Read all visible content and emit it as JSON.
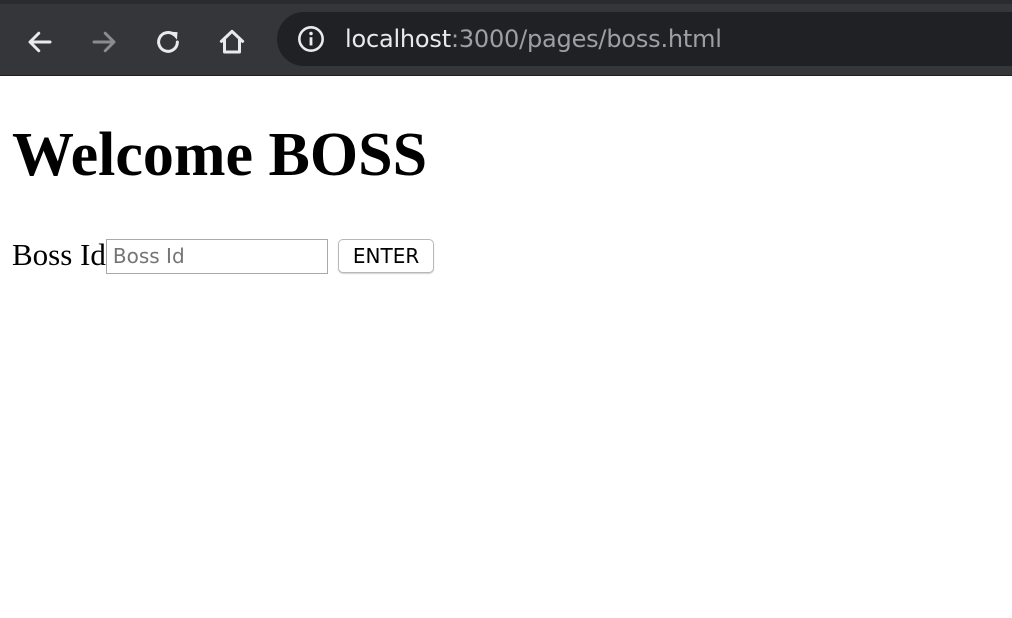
{
  "browser": {
    "url_host": "localhost",
    "url_rest": ":3000/pages/boss.html",
    "icons": {
      "back": "arrow-left-icon",
      "forward": "arrow-right-icon",
      "reload": "reload-icon",
      "home": "home-icon",
      "site_info": "info-icon"
    },
    "colors": {
      "toolbar": "#35363a",
      "omnibox": "#202124",
      "icon_active": "#e8eaed",
      "icon_disabled": "#8a8c90"
    }
  },
  "page": {
    "title": "Welcome BOSS",
    "form": {
      "label": "Boss Id",
      "input_value": "",
      "input_placeholder": "Boss Id",
      "button_label": "ENTER"
    }
  }
}
